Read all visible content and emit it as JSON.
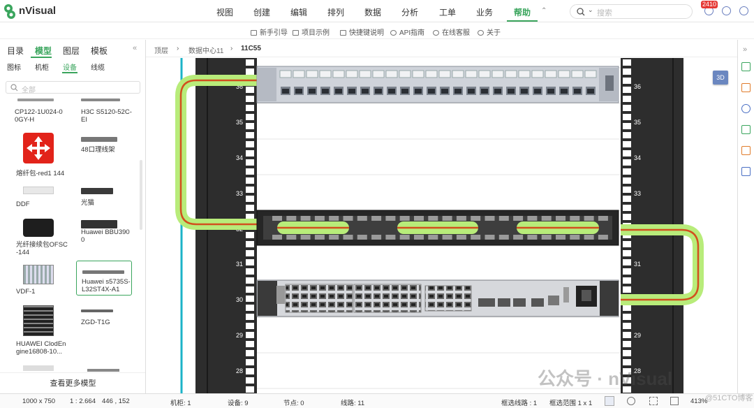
{
  "app": {
    "name": "nVisual"
  },
  "menu": [
    "视图",
    "创建",
    "编辑",
    "排列",
    "数据",
    "分析",
    "工单",
    "业务",
    "帮助"
  ],
  "menu_active": "帮助",
  "search": {
    "placeholder": "搜索"
  },
  "notif_badge": "2410",
  "help_bar": [
    "新手引导",
    "项目示例",
    "快捷键说明",
    "API指南",
    "在线客服",
    "关于"
  ],
  "left": {
    "tabs": [
      "目录",
      "模型",
      "图层",
      "模板"
    ],
    "sub_tabs": [
      "图标",
      "机柜",
      "设备",
      "线缆"
    ],
    "search_placeholder": "全部",
    "models": [
      {
        "label": "CP122-1U024-0\n0GY-H"
      },
      {
        "label": "H3C S5120-52C-\nEI"
      },
      {
        "label": "熔纤包-red1 144"
      },
      {
        "label": "48口理线架"
      },
      {
        "label": "DDF"
      },
      {
        "label": "光猫"
      },
      {
        "label": "光纤接续包OFSC\n-144"
      },
      {
        "label": "Huawei BBU390\n0"
      },
      {
        "label": "VDF-1"
      },
      {
        "label": "Huawei s5735S-\nL32ST4X-A1"
      },
      {
        "label": "HUAWEI ClodEn\ngine16808-10..."
      },
      {
        "label": "ZGD-T1G"
      }
    ],
    "more_button": "查看更多模型"
  },
  "breadcrumb": [
    "顶层",
    "数据中心11",
    "11C55"
  ],
  "rack": {
    "u_labels": [
      "36",
      "35",
      "34",
      "33",
      "32",
      "31",
      "30",
      "29",
      "28"
    ]
  },
  "view_3d": "3D",
  "status": {
    "canvas_size": "1000 x 750",
    "scale": "1 : 2.664",
    "coords": "446 , 152",
    "cabinets": "机柜: 1",
    "devices": "设备: 9",
    "nodes": "节点: 0",
    "lines": "线路: 11",
    "sel_lines": "框选线路 : 1",
    "sel_range": "框选范围 1 x 1",
    "zoom": "413%"
  },
  "watermark": "公众号 · nVisual",
  "watermark2": "@51CTO博客",
  "colors": {
    "accent": "#3aa55d",
    "cable_glow": "#b8ec7a",
    "cable_core": "#d2501e",
    "rack": "#2e2e2e"
  }
}
